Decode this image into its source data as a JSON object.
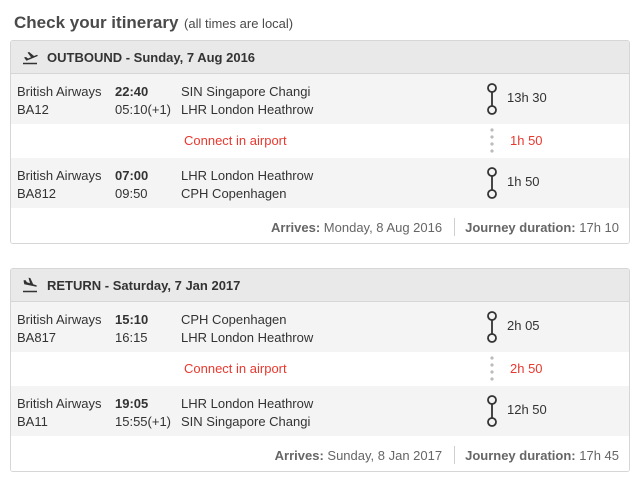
{
  "page": {
    "title": "Check your itinerary",
    "subtitle": "(all times are local)"
  },
  "outbound": {
    "title": "OUTBOUND - Sunday, 7 Aug 2016",
    "icon": "plane-takeoff-icon",
    "segments": [
      {
        "airline": "British Airways",
        "flight": "BA12",
        "dep_time": "22:40",
        "arr_time": "05:10(+1)",
        "from": "SIN Singapore Changi",
        "to": "LHR London Heathrow",
        "duration": "13h 30"
      },
      {
        "airline": "British Airways",
        "flight": "BA812",
        "dep_time": "07:00",
        "arr_time": "09:50",
        "from": "LHR London Heathrow",
        "to": "CPH Copenhagen",
        "duration": "1h 50"
      }
    ],
    "connection": {
      "label": "Connect in airport",
      "duration": "1h 50"
    },
    "arrives_label": "Arrives:",
    "arrives_value": "Monday, 8 Aug 2016",
    "journey_label": "Journey duration:",
    "journey_value": "17h 10"
  },
  "return": {
    "title": "RETURN - Saturday, 7 Jan 2017",
    "icon": "plane-landing-icon",
    "segments": [
      {
        "airline": "British Airways",
        "flight": "BA817",
        "dep_time": "15:10",
        "arr_time": "16:15",
        "from": "CPH Copenhagen",
        "to": "LHR London Heathrow",
        "duration": "2h 05"
      },
      {
        "airline": "British Airways",
        "flight": "BA11",
        "dep_time": "19:05",
        "arr_time": "15:55(+1)",
        "from": "LHR London Heathrow",
        "to": "SIN Singapore Changi",
        "duration": "12h 50"
      }
    ],
    "connection": {
      "label": "Connect in airport",
      "duration": "2h 50"
    },
    "arrives_label": "Arrives:",
    "arrives_value": "Sunday, 8 Jan 2017",
    "journey_label": "Journey duration:",
    "journey_value": "17h 45"
  },
  "colors": {
    "header_bg": "#e9e9e9",
    "row_shade": "#f4f4f4",
    "connect_red": "#e8392f",
    "border": "#d6d6d6"
  }
}
